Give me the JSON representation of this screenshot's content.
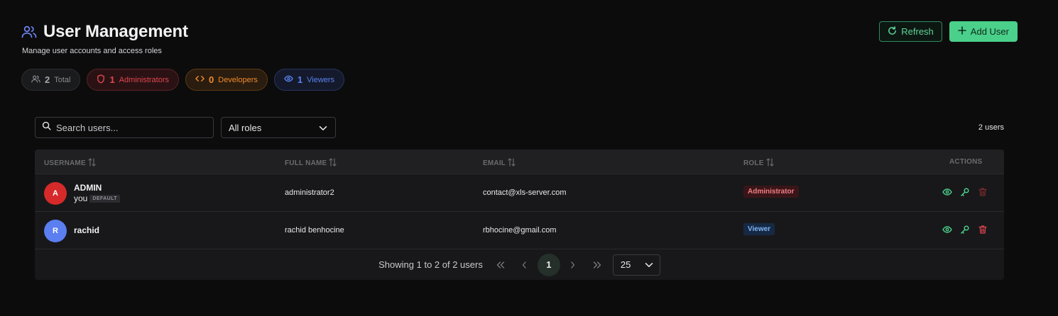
{
  "header": {
    "icon": "users-icon",
    "title": "User Management",
    "subtitle": "Manage user accounts and access roles",
    "refresh_label": "Refresh",
    "add_user_label": "Add User"
  },
  "stats": {
    "total": {
      "count": "2",
      "label": "Total"
    },
    "administrators": {
      "count": "1",
      "label": "Administrators"
    },
    "developers": {
      "count": "0",
      "label": "Developers"
    },
    "viewers": {
      "count": "1",
      "label": "Viewers"
    }
  },
  "filters": {
    "search_placeholder": "Search users...",
    "role_selected": "All roles",
    "count_text": "2 users"
  },
  "table": {
    "columns": [
      "USERNAME",
      "FULL NAME",
      "EMAIL",
      "ROLE",
      "ACTIONS"
    ],
    "rows": [
      {
        "initial": "A",
        "username": "ADMIN",
        "you_label": "you",
        "default_tag": "DEFAULT",
        "full_name": "administrator2",
        "email": "contact@xls-server.com",
        "role": "Administrator",
        "avatar_color": "#d62a2a"
      },
      {
        "initial": "R",
        "username": "rachid",
        "full_name": "rachid benhocine",
        "email": "rbhocine@gmail.com",
        "role": "Viewer",
        "avatar_color": "#5b7ef0"
      }
    ]
  },
  "pagination": {
    "showing_text": "Showing 1 to 2 of 2 users",
    "current_page": "1",
    "per_page": "25"
  },
  "colors": {
    "accent_green": "#4ad08a",
    "admin_red": "#e0464f",
    "dev_orange": "#f08b2c",
    "viewer_blue": "#5b82f0"
  }
}
